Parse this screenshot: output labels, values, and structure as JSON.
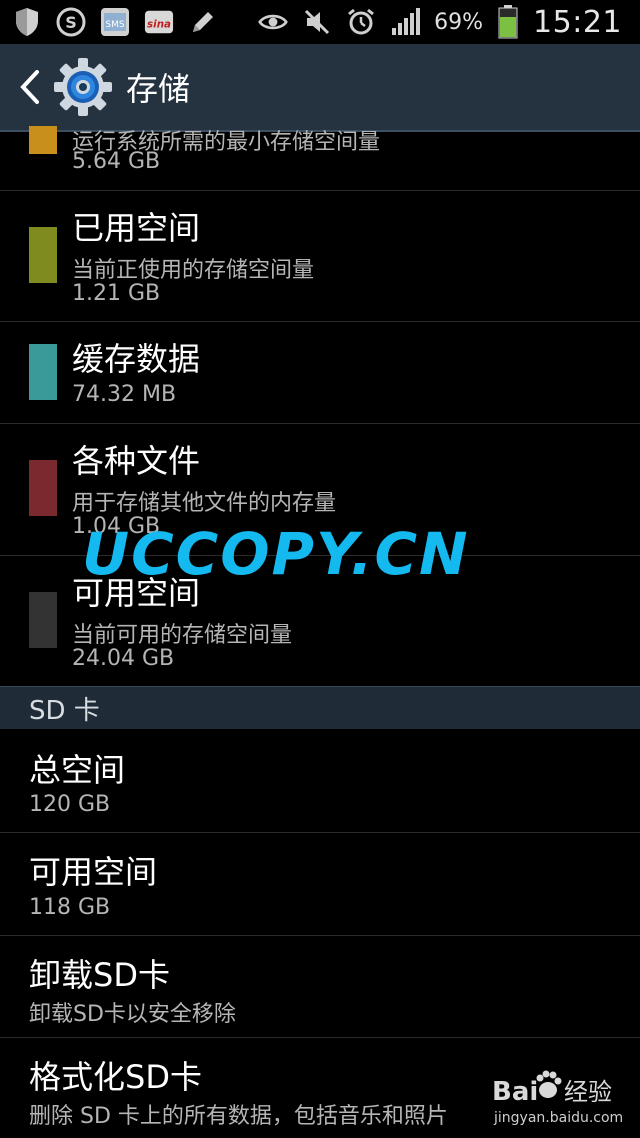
{
  "status_bar": {
    "icons_left": [
      "shield-icon",
      "sogou-icon",
      "sms-icon",
      "sina-icon",
      "pen-icon"
    ],
    "icons_right": [
      "eye-icon",
      "mute-icon",
      "alarm-icon",
      "signal-icon"
    ],
    "battery": "69%",
    "time": "15:21"
  },
  "action_bar": {
    "title": "存储"
  },
  "storage_items": [
    {
      "title": "",
      "subtitle": "运行系统所需的最小存储空间量",
      "value": "5.64 GB",
      "color": "#c8901a"
    },
    {
      "title": "已用空间",
      "subtitle": "当前正使用的存储空间量",
      "value": "1.21 GB",
      "color": "#7f8a1f"
    },
    {
      "title": "缓存数据",
      "subtitle": "",
      "value": "74.32 MB",
      "color": "#3a9a9a"
    },
    {
      "title": "各种文件",
      "subtitle": "用于存储其他文件的内存量",
      "value": "1.04 GB",
      "color": "#7a2a2e"
    },
    {
      "title": "可用空间",
      "subtitle": "当前可用的存储空间量",
      "value": "24.04 GB",
      "color": "#333333"
    }
  ],
  "sd_section": {
    "header": "SD 卡"
  },
  "sd_items": [
    {
      "title": "总空间",
      "subtitle": "120 GB"
    },
    {
      "title": "可用空间",
      "subtitle": "118 GB"
    },
    {
      "title": "卸载SD卡",
      "subtitle": "卸载SD卡以安全移除"
    },
    {
      "title": "格式化SD卡",
      "subtitle": "删除 SD 卡上的所有数据，包括音乐和照片"
    }
  ],
  "watermarks": {
    "uccopy": "UCCOPY.CN",
    "baidu_brand": "Bai",
    "baidu_jingyan": "经验",
    "baidu_url": "jingyan.baidu.com"
  }
}
